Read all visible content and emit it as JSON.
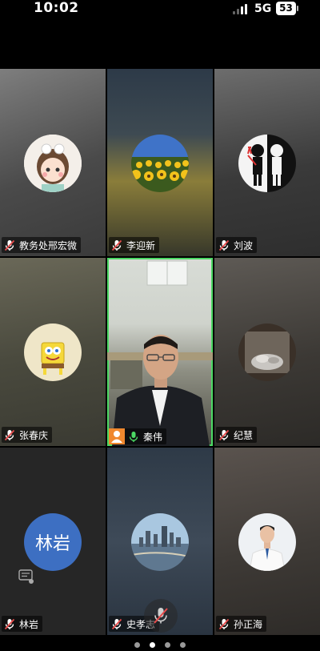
{
  "status": {
    "time": "10:02",
    "network": "5G",
    "battery": "53"
  },
  "participants": [
    {
      "name": "教务处邢宏微",
      "muted": true
    },
    {
      "name": "李迎新",
      "muted": true
    },
    {
      "name": "刘波",
      "muted": true
    },
    {
      "name": "张春庆",
      "muted": true
    },
    {
      "name": "秦伟",
      "muted": false,
      "active_speaker": true
    },
    {
      "name": "纪慧",
      "muted": true
    },
    {
      "name": "林岩",
      "muted": true,
      "avatar_text": "林岩"
    },
    {
      "name": "史孝志",
      "muted": true
    },
    {
      "name": "孙正海",
      "muted": true
    }
  ],
  "pager": {
    "pages": 4,
    "current": 2
  },
  "colors": {
    "active_border": "#4cd964",
    "avatar_blue": "#3d6fc2",
    "host_badge": "#f0882e"
  }
}
